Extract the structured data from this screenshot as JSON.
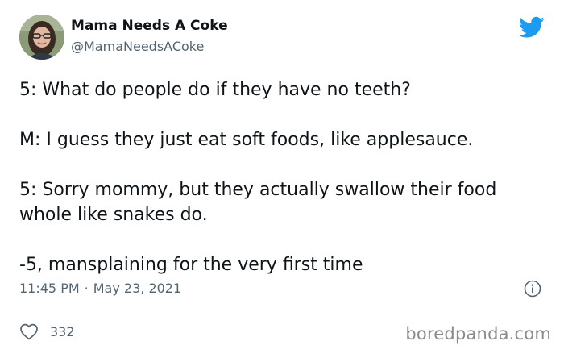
{
  "author": {
    "display_name": "Mama Needs A Coke",
    "handle": "@MamaNeedsACoke"
  },
  "tweet": {
    "lines": [
      "5: What do people do if they have no teeth?",
      "M: I guess they just eat soft foods, like applesauce.",
      "5: Sorry mommy, but they actually swallow their food whole like snakes do.",
      "-5, mansplaining for the very first time"
    ],
    "time": "11:45 PM",
    "separator": "·",
    "date": "May 23, 2021"
  },
  "actions": {
    "like_count": "332"
  },
  "watermark": "boredpanda.com",
  "colors": {
    "text": "#0f1419",
    "secondary": "#536471",
    "twitter_blue": "#1d9bf0",
    "divider": "#cfd9de"
  },
  "icons": [
    "avatar-photo",
    "twitter-bird-icon",
    "info-icon",
    "heart-icon"
  ]
}
